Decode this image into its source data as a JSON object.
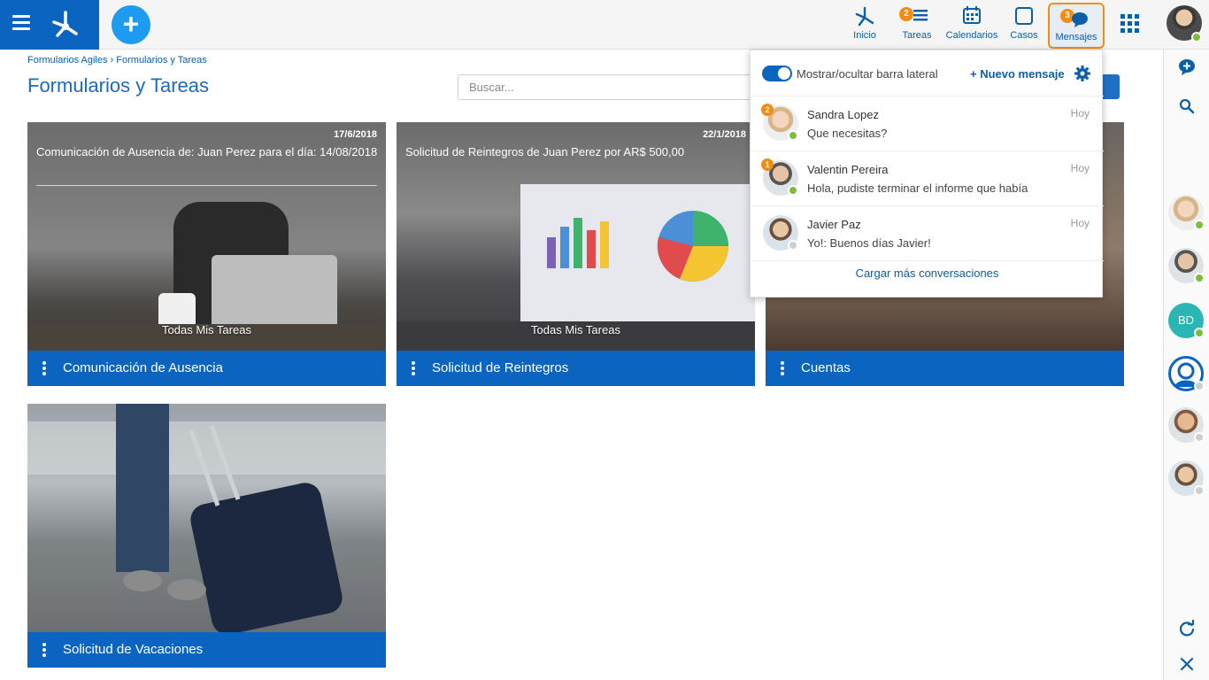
{
  "topbar": {
    "nav": {
      "inicio": "Inicio",
      "tareas": "Tareas",
      "tareas_badge": "2",
      "calendarios": "Calendarios",
      "casos": "Casos",
      "mensajes": "Mensajes",
      "mensajes_badge": "3"
    }
  },
  "breadcrumb": {
    "items": [
      "Formularios Agiles",
      "Formularios y Tareas"
    ],
    "separator": "›"
  },
  "page": {
    "title": "Formularios y Tareas",
    "search_placeholder": "Buscar..."
  },
  "cards": [
    {
      "date": "17/6/2018",
      "title": "Comunicación de Ausencia de: Juan Perez para el día: 14/08/2018",
      "sub": "Todas Mis Tareas",
      "label": "Comunicación de Ausencia"
    },
    {
      "date": "22/1/2018",
      "title": "Solicitud de Reintegros de Juan  Perez por  AR$  500,00",
      "sub": "Todas Mis Tareas",
      "label": "Solicitud de Reintegros"
    },
    {
      "label": "Cuentas"
    },
    {
      "label": "Solicitud de Vacaciones"
    }
  ],
  "popup": {
    "toggle_label": "Mostrar/ocultar barra lateral",
    "new_message": "+ Nuevo mensaje",
    "conversations": [
      {
        "name": "Sandra Lopez",
        "time": "Hoy",
        "message": "Que necesitas?",
        "badge": "2",
        "status": "online"
      },
      {
        "name": "Valentin Pereira",
        "time": "Hoy",
        "message": "Hola, pudiste terminar el informe que había",
        "badge": "1",
        "status": "online"
      },
      {
        "name": "Javier Paz",
        "time": "Hoy",
        "message": "Yo!: Buenos días Javier!",
        "status": "offline"
      }
    ],
    "load_more": "Cargar más conversaciones"
  },
  "sidebar": {
    "contacts": [
      {
        "status": "online"
      },
      {
        "status": "online"
      },
      {
        "initials": "BD",
        "status": "online"
      },
      {
        "status": "offline"
      },
      {
        "status": "offline"
      },
      {
        "status": "offline"
      }
    ]
  },
  "colors": {
    "primary": "#0b64c0",
    "accent_orange": "#f28c13",
    "online": "#7cbd3a"
  }
}
